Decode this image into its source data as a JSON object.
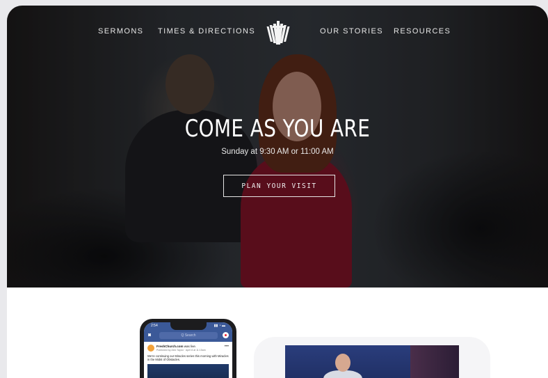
{
  "nav": {
    "left": [
      "SERMONS",
      "TIMES & DIRECTIONS"
    ],
    "right": [
      "OUR STORIES",
      "RESOURCES"
    ]
  },
  "hero": {
    "title": "COME AS YOU ARE",
    "subtitle": "Sunday at 9:30 AM or 11:00 AM",
    "cta_label": "PLAN YOUR VISIT"
  },
  "phone": {
    "status_time": "2:54",
    "search_placeholder": "Q Search",
    "post_page": "FreshChurch.com",
    "post_action": "was live.",
    "post_meta": "Published by Alex Taylor · April 8 at 11:15am",
    "post_text": "We're continuing our Miracles series this morning with Miracles in the Midst of Obstacles."
  },
  "icons": {
    "logo": "church-logo-icon",
    "camera": "camera-icon",
    "messenger": "messenger-icon",
    "more": "more-options-icon"
  },
  "colors": {
    "facebook_blue": "#3b5998",
    "cta_border": "#e6e6e6",
    "accent_red": "#7a1226"
  }
}
